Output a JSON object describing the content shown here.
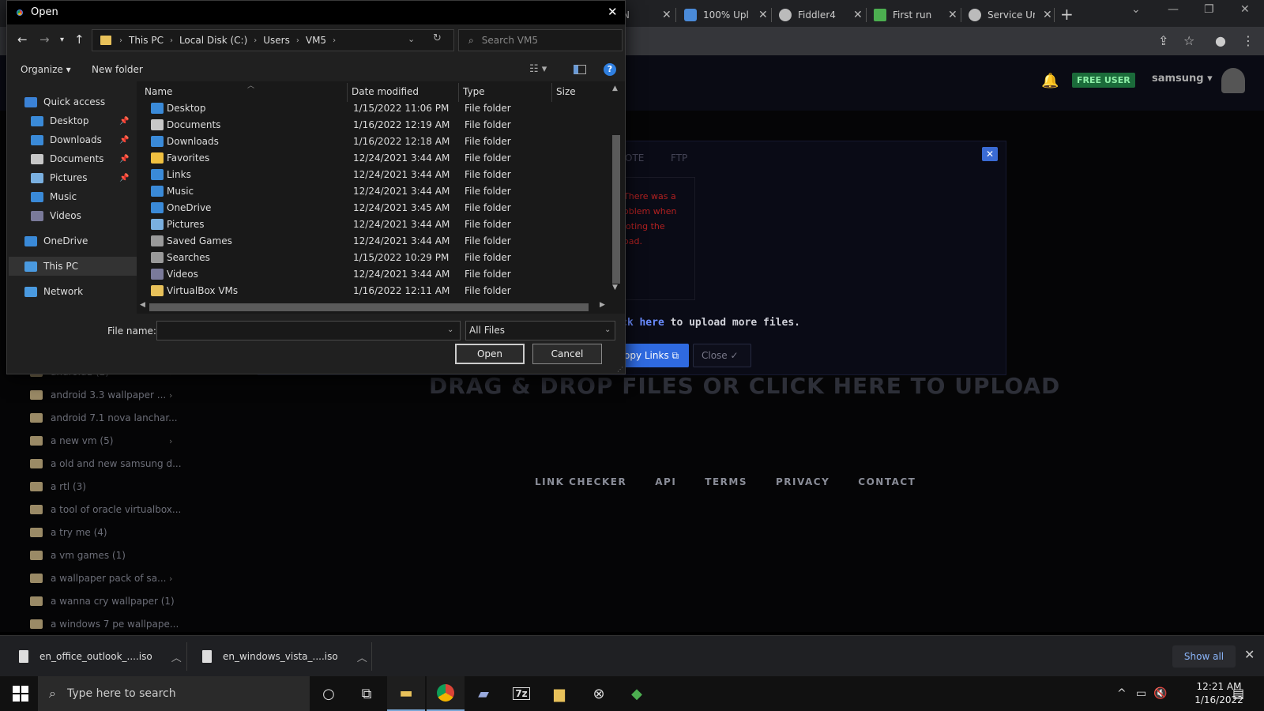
{
  "browser": {
    "tabs": [
      {
        "title": "N",
        "icon_color": "#e8eaed"
      },
      {
        "title": "100% Upl",
        "icon_color": "#4a8ad8"
      },
      {
        "title": "Fiddler4",
        "icon_color": "#bbbbbb"
      },
      {
        "title": "First run",
        "icon_color": "#4caf50"
      },
      {
        "title": "Service Ur",
        "icon_color": "#bbbbbb"
      }
    ],
    "new_tab": "+",
    "window_controls": {
      "dropdown": "⌄",
      "minimize": "—",
      "maximize": "❐",
      "close": "✕"
    }
  },
  "site": {
    "header": {
      "badge": "FREE USER",
      "username": "samsung ▾"
    },
    "panel": {
      "tabs": [
        "OTE",
        "FTP"
      ],
      "close": "✕",
      "error_lines": [
        "There was a",
        "oblem when",
        "loting the",
        "oad."
      ],
      "more_files_link": "ck here",
      "more_files_rest": " to upload more files.",
      "copy_links": "opy Links ⧉",
      "close_button": "Close ✓"
    },
    "drag_drop": "DRAG & DROP FILES OR CLICK HERE TO UPLOAD",
    "footer_links": [
      "LINK CHECKER",
      "API",
      "TERMS",
      "PRIVACY",
      "CONTACT"
    ],
    "folders": [
      {
        "name": "android1 (2)",
        "chevron": true
      },
      {
        "name": "android 3.3 wallpaper ...",
        "chevron": true
      },
      {
        "name": "android 7.1 nova lanchar...",
        "chevron": false
      },
      {
        "name": "a new vm (5)",
        "chevron": true
      },
      {
        "name": "a old and new samsung d...",
        "chevron": false
      },
      {
        "name": "a rtl (3)",
        "chevron": false
      },
      {
        "name": "a tool of oracle virtualbox...",
        "chevron": false
      },
      {
        "name": "a try me (4)",
        "chevron": false
      },
      {
        "name": "a vm games (1)",
        "chevron": false
      },
      {
        "name": "a wallpaper pack of sa...",
        "chevron": true
      },
      {
        "name": "a wanna cry wallpaper (1)",
        "chevron": false
      },
      {
        "name": "a windows 7 pe wallpape...",
        "chevron": false
      }
    ]
  },
  "downloads": {
    "items": [
      "en_office_outlook_....iso",
      "en_windows_vista_....iso"
    ],
    "show_all": "Show all",
    "close": "✕"
  },
  "taskbar": {
    "search_placeholder": "Type here to search",
    "apps": [
      "cortana",
      "task-view",
      "file-explorer",
      "chrome",
      "notepad",
      "7zip",
      "folder",
      "xbox",
      "fiddler"
    ],
    "time": "12:21 AM",
    "date": "1/16/2022",
    "notifications": "1"
  },
  "dialog": {
    "title": "Open",
    "close": "✕",
    "breadcrumb": [
      "This PC",
      "Local Disk (C:)",
      "Users",
      "VM5"
    ],
    "search_placeholder": "Search VM5",
    "organize": "Organize ▾",
    "new_folder": "New folder",
    "help": "?",
    "nav": [
      {
        "label": "Quick access",
        "icon_color": "#3b82d6",
        "indent": 0,
        "pinned": false
      },
      {
        "label": "Desktop",
        "icon_color": "#3a8ad8",
        "indent": 1,
        "pinned": true
      },
      {
        "label": "Downloads",
        "icon_color": "#3a8ad8",
        "indent": 1,
        "pinned": true
      },
      {
        "label": "Documents",
        "icon_color": "#c8c8c8",
        "indent": 1,
        "pinned": true
      },
      {
        "label": "Pictures",
        "icon_color": "#7ab0e0",
        "indent": 1,
        "pinned": true
      },
      {
        "label": "Music",
        "icon_color": "#3a8ad8",
        "indent": 1,
        "pinned": false
      },
      {
        "label": "Videos",
        "icon_color": "#7a7a9a",
        "indent": 1,
        "pinned": false
      },
      {
        "label": "OneDrive",
        "icon_color": "#3a8ad8",
        "indent": 0,
        "pinned": false
      },
      {
        "label": "This PC",
        "icon_color": "#4a9ae0",
        "indent": 0,
        "pinned": false
      },
      {
        "label": "Network",
        "icon_color": "#4a9ae0",
        "indent": 0,
        "pinned": false
      }
    ],
    "selected_nav": "This PC",
    "columns": [
      "Name",
      "Date modified",
      "Type",
      "Size"
    ],
    "rows": [
      {
        "name": "Desktop",
        "date": "1/15/2022 11:06 PM",
        "type": "File folder",
        "icon_color": "#3a8ad8"
      },
      {
        "name": "Documents",
        "date": "1/16/2022 12:19 AM",
        "type": "File folder",
        "icon_color": "#c8c8c8"
      },
      {
        "name": "Downloads",
        "date": "1/16/2022 12:18 AM",
        "type": "File folder",
        "icon_color": "#3a8ad8"
      },
      {
        "name": "Favorites",
        "date": "12/24/2021 3:44 AM",
        "type": "File folder",
        "icon_color": "#f0c040"
      },
      {
        "name": "Links",
        "date": "12/24/2021 3:44 AM",
        "type": "File folder",
        "icon_color": "#3a8ad8"
      },
      {
        "name": "Music",
        "date": "12/24/2021 3:44 AM",
        "type": "File folder",
        "icon_color": "#3a8ad8"
      },
      {
        "name": "OneDrive",
        "date": "12/24/2021 3:45 AM",
        "type": "File folder",
        "icon_color": "#3a8ad8"
      },
      {
        "name": "Pictures",
        "date": "12/24/2021 3:44 AM",
        "type": "File folder",
        "icon_color": "#7ab0e0"
      },
      {
        "name": "Saved Games",
        "date": "12/24/2021 3:44 AM",
        "type": "File folder",
        "icon_color": "#9a9a9a"
      },
      {
        "name": "Searches",
        "date": "1/15/2022 10:29 PM",
        "type": "File folder",
        "icon_color": "#9a9a9a"
      },
      {
        "name": "Videos",
        "date": "12/24/2021 3:44 AM",
        "type": "File folder",
        "icon_color": "#7a7a9a"
      },
      {
        "name": "VirtualBox VMs",
        "date": "1/16/2022 12:11 AM",
        "type": "File folder",
        "icon_color": "#e8c15a"
      }
    ],
    "file_name_label": "File name:",
    "file_name_value": "",
    "file_type": "All Files",
    "open_button": "Open",
    "cancel_button": "Cancel"
  }
}
